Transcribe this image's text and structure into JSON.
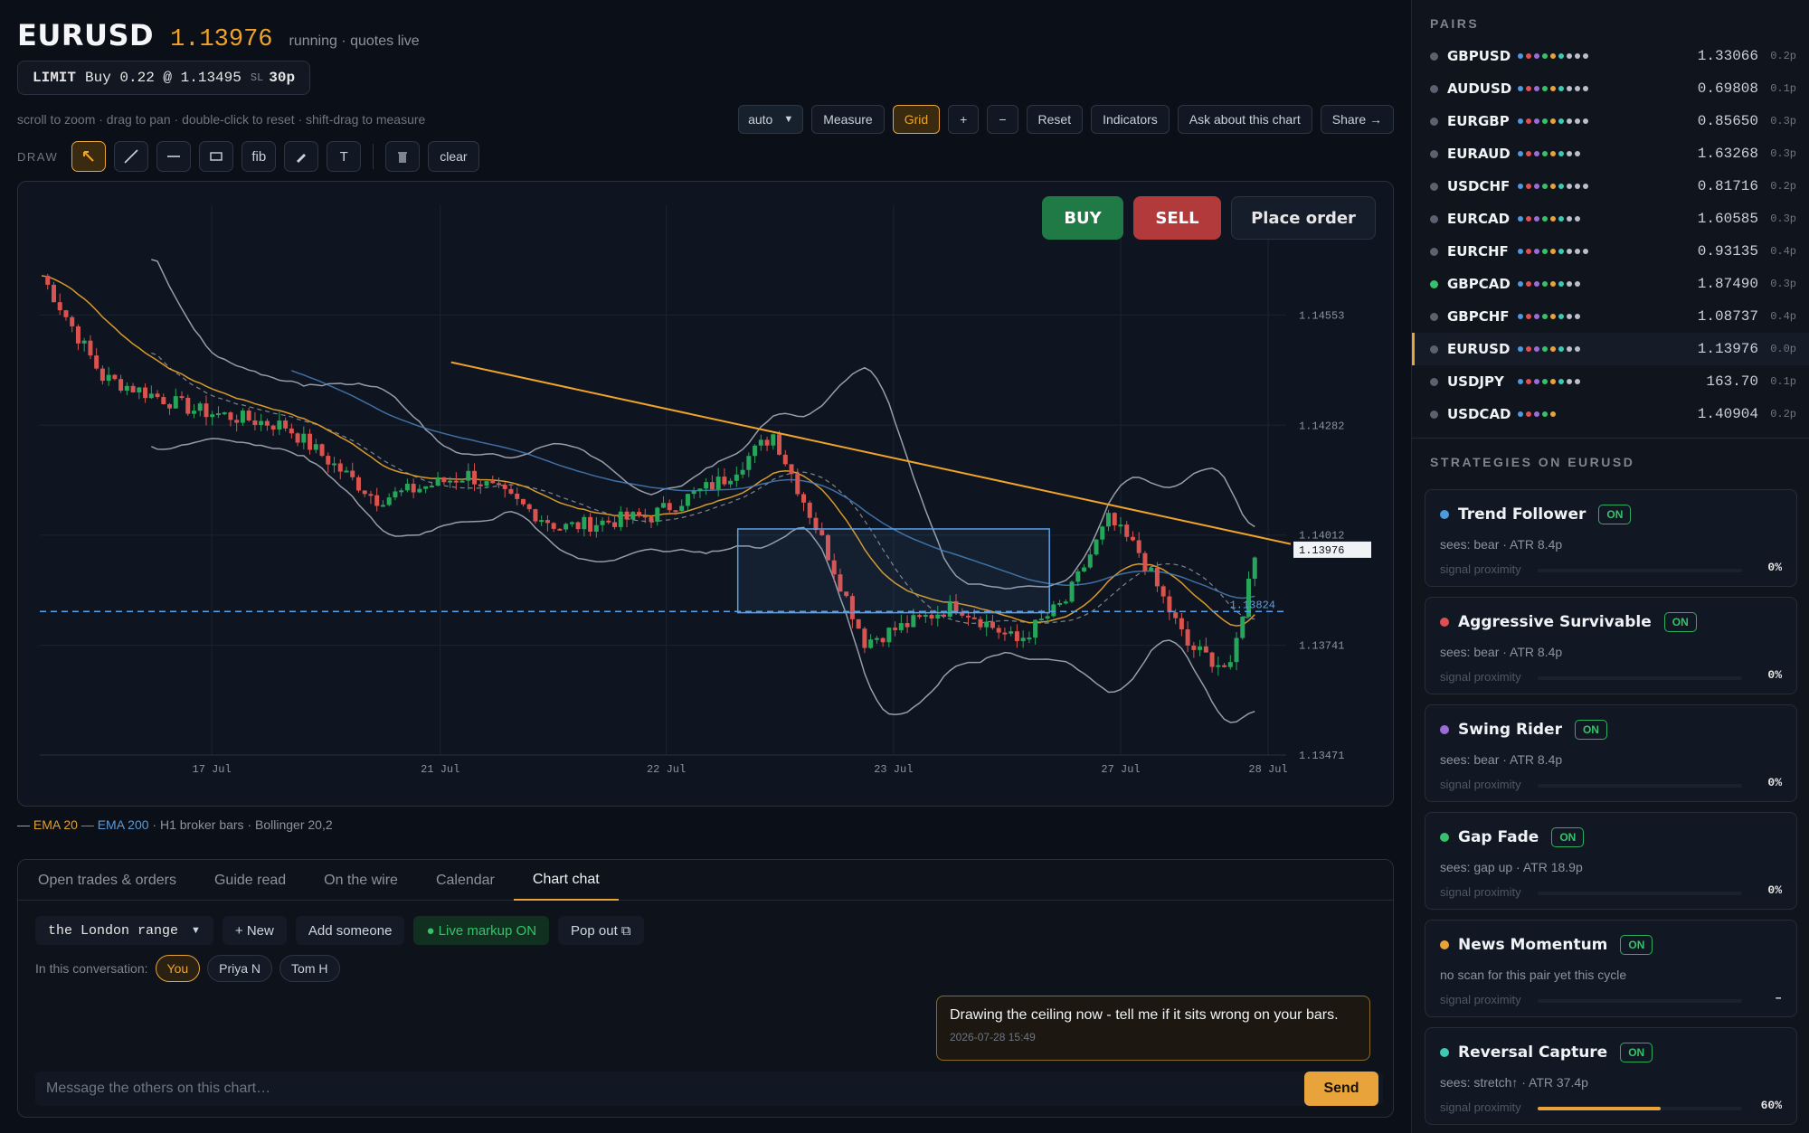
{
  "header": {
    "symbol": "EURUSD",
    "price": "1.13976",
    "status": "running · quotes live"
  },
  "order_ticket": {
    "type": "LIMIT",
    "detail": "Buy 0.22 @ 1.13495",
    "sl_label": "SL",
    "sl_value": "30p"
  },
  "hint": "scroll to zoom · drag to pan · double-click to reset · shift-drag to measure",
  "toolbar": {
    "timeframe": "auto",
    "measure": "Measure",
    "grid": "Grid",
    "zoom_in": "+",
    "zoom_out": "−",
    "reset": "Reset",
    "indicators": "Indicators",
    "ask": "Ask about this chart",
    "share": "Share →"
  },
  "draw": {
    "label": "DRAW",
    "tools": [
      "cursor-icon",
      "line-icon",
      "hline-icon",
      "rect-icon",
      "fib",
      "pen-icon",
      "text-icon"
    ],
    "fib": "fib",
    "text": "T",
    "clear": "clear"
  },
  "trade": {
    "buy": "BUY",
    "sell": "SELL",
    "place": "Place order"
  },
  "chart_data": {
    "type": "candlestick",
    "symbol": "EURUSD",
    "timeframe": "H1",
    "x_labels": [
      "17 Jul",
      "21 Jul",
      "22 Jul",
      "23 Jul",
      "27 Jul",
      "28 Jul"
    ],
    "y_ticks": [
      "1.14553",
      "1.14282",
      "1.14012",
      "1.13741",
      "1.13471"
    ],
    "ylim": [
      1.13471,
      1.14823
    ],
    "last_price": "1.13976",
    "order_level": "1.13824",
    "indicators": [
      "EMA 20",
      "EMA 200",
      "Bollinger 20,2"
    ],
    "grid": true,
    "colors": {
      "up": "#26a65b",
      "down": "#d9534f",
      "ema20": "#d79a2b",
      "ema200": "#4a86c5",
      "trendline": "#f0a32a",
      "order": "#5aa0e6",
      "bands": "#b9c0cc"
    },
    "trendline": [
      {
        "x": 0.33,
        "y": 1.14437
      },
      {
        "x": 1.0,
        "y": 1.1399
      }
    ],
    "range_box": {
      "x0": 0.56,
      "x1": 0.81,
      "top": 1.14027,
      "bottom": 1.13821
    }
  },
  "legend": {
    "ema20": "— EMA 20",
    "ema200": "— EMA 200",
    "bars": "· H1 broker bars",
    "boll": "· Bollinger 20,2"
  },
  "panel": {
    "tabs": [
      "Open trades & orders",
      "Guide read",
      "On the wire",
      "Calendar",
      "Chart chat"
    ],
    "active_tab": "Chart chat",
    "conversation": "the London range",
    "new": "+ New",
    "add": "Add someone",
    "markup": "● Live markup ON",
    "popout": "Pop out ⧉",
    "participants_label": "In this conversation:",
    "participants": [
      "You",
      "Priya N",
      "Tom H"
    ],
    "message": {
      "text": "Drawing the ceiling now - tell me if it sits wrong on your bars.",
      "time": "2026-07-28 15:49"
    },
    "input_placeholder": "Message the others on this chart…",
    "send": "Send"
  },
  "pairs_title": "PAIRS",
  "pairs": [
    {
      "name": "GBPUSD",
      "price": "1.33066",
      "spread": "0.2p",
      "dot": "#5a6270"
    },
    {
      "name": "AUDUSD",
      "price": "0.69808",
      "spread": "0.1p",
      "dot": "#5a6270"
    },
    {
      "name": "EURGBP",
      "price": "0.85650",
      "spread": "0.3p",
      "dot": "#5a6270"
    },
    {
      "name": "EURAUD",
      "price": "1.63268",
      "spread": "0.3p",
      "dot": "#5a6270"
    },
    {
      "name": "USDCHF",
      "price": "0.81716",
      "spread": "0.2p",
      "dot": "#5a6270"
    },
    {
      "name": "EURCAD",
      "price": "1.60585",
      "spread": "0.3p",
      "dot": "#5a6270"
    },
    {
      "name": "EURCHF",
      "price": "0.93135",
      "spread": "0.4p",
      "dot": "#5a6270"
    },
    {
      "name": "GBPCAD",
      "price": "1.87490",
      "spread": "0.3p",
      "dot": "#35c26b"
    },
    {
      "name": "GBPCHF",
      "price": "1.08737",
      "spread": "0.4p",
      "dot": "#5a6270"
    },
    {
      "name": "EURUSD",
      "price": "1.13976",
      "spread": "0.0p",
      "dot": "#5a6270"
    },
    {
      "name": "USDJPY",
      "price": "163.70",
      "spread": "0.1p",
      "dot": "#5a6270"
    },
    {
      "name": "USDCAD",
      "price": "1.40904",
      "spread": "0.2p",
      "dot": "#5a6270"
    }
  ],
  "strategies_title": "STRATEGIES ON EURUSD",
  "strategies": [
    {
      "name": "Trend Follower",
      "badge": "ON",
      "sub": "sees: bear · ATR 8.4p",
      "prox_label": "signal proximity",
      "pct": "0%",
      "fill": 0,
      "color": "#4a9be0"
    },
    {
      "name": "Aggressive Survivable",
      "badge": "ON",
      "sub": "sees: bear · ATR 8.4p",
      "prox_label": "signal proximity",
      "pct": "0%",
      "fill": 0,
      "color": "#e05050"
    },
    {
      "name": "Swing Rider",
      "badge": "ON",
      "sub": "sees: bear · ATR 8.4p",
      "prox_label": "signal proximity",
      "pct": "0%",
      "fill": 0,
      "color": "#9b6bdc"
    },
    {
      "name": "Gap Fade",
      "badge": "ON",
      "sub": "sees: gap up · ATR 18.9p",
      "prox_label": "signal proximity",
      "pct": "0%",
      "fill": 0,
      "color": "#35c26b"
    },
    {
      "name": "News Momentum",
      "badge": "ON",
      "sub": "no scan for this pair yet this cycle",
      "prox_label": "signal proximity",
      "pct": "–",
      "fill": 0,
      "color": "#e8a33a"
    },
    {
      "name": "Reversal Capture",
      "badge": "ON",
      "sub": "sees: stretch↑ · ATR 37.4p",
      "prox_label": "signal proximity",
      "pct": "60%",
      "fill": 0.6,
      "color": "#3ec9b5"
    }
  ]
}
